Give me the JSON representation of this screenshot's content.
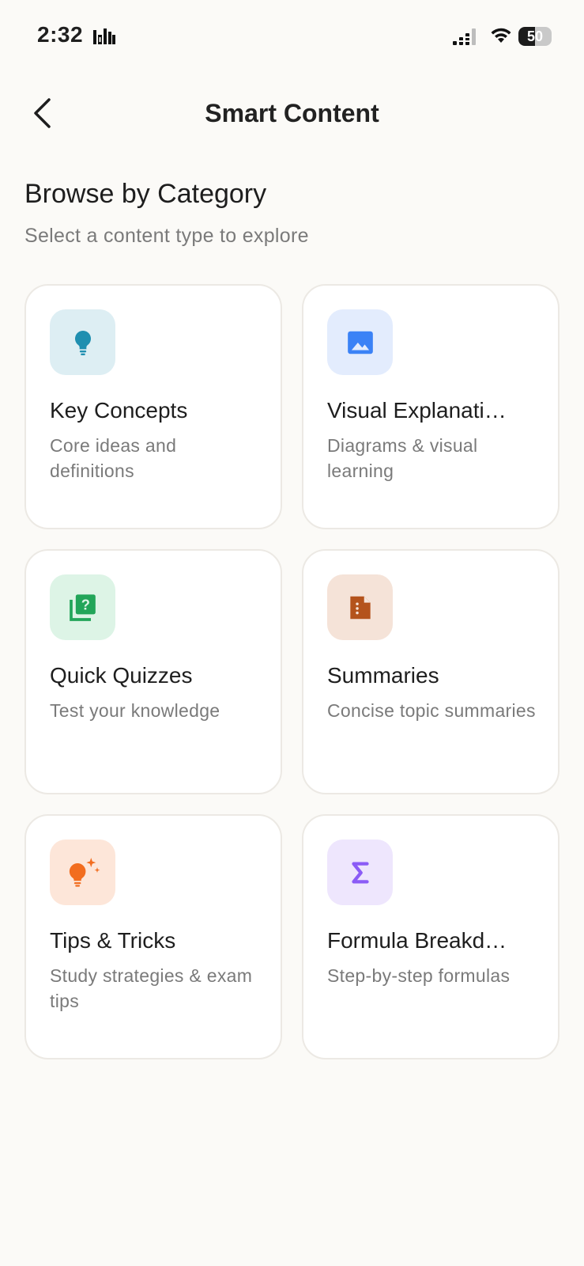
{
  "status_bar": {
    "time": "2:32",
    "battery": "50",
    "battery_level": 0.5
  },
  "header": {
    "title": "Smart Content"
  },
  "section": {
    "title": "Browse by Category",
    "subtitle": "Select a content type to explore"
  },
  "categories": [
    {
      "title": "Key Concepts",
      "description": "Core ideas and definitions",
      "icon": "lightbulb-icon",
      "icon_color": "#1F8FB0",
      "tile_color": "#DDEEF3"
    },
    {
      "title": "Visual Explanati…",
      "description": "Diagrams & visual learning",
      "icon": "image-icon",
      "icon_color": "#3B82F6",
      "tile_color": "#E3ECFD"
    },
    {
      "title": "Quick Quizzes",
      "description": "Test your knowledge",
      "icon": "quiz-icon",
      "icon_color": "#22A559",
      "tile_color": "#DDF4E6"
    },
    {
      "title": "Summaries",
      "description": "Concise topic summaries",
      "icon": "document-icon",
      "icon_color": "#B4531C",
      "tile_color": "#F5E3D8"
    },
    {
      "title": "Tips & Tricks",
      "description": "Study strategies & exam tips",
      "icon": "sparkle-bulb-icon",
      "icon_color": "#F26D1F",
      "tile_color": "#FDE6D9"
    },
    {
      "title": "Formula Breakd…",
      "description": "Step-by-step formulas",
      "icon": "sigma-icon",
      "icon_color": "#8B5CF6",
      "tile_color": "#EEE6FD"
    }
  ]
}
